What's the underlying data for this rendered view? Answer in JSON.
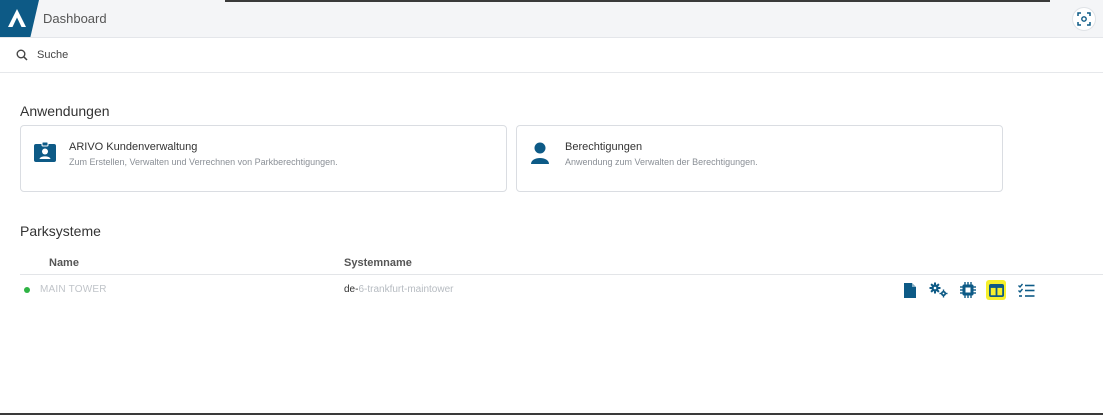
{
  "header": {
    "title": "Dashboard"
  },
  "search": {
    "placeholder": "Suche"
  },
  "applications": {
    "title": "Anwendungen",
    "cards": [
      {
        "title": "ARIVO Kundenverwaltung",
        "description": "Zum Erstellen, Verwalten und Verrechnen von Parkberechtigungen.",
        "icon": "id-badge-icon"
      },
      {
        "title": "Berechtigungen",
        "description": "Anwendung zum Verwalten der Berechtigungen.",
        "icon": "user-icon"
      }
    ]
  },
  "parksysteme": {
    "title": "Parksysteme",
    "columns": [
      "Name",
      "Systemname"
    ],
    "rows": [
      {
        "status": "online",
        "name": "MAIN TOWER",
        "system_prefix": "de-",
        "system_rest": "6-trankfurt-maintower",
        "actions": [
          "document-icon",
          "settings-gears-icon",
          "chip-icon",
          "columns-icon",
          "checklist-icon"
        ]
      }
    ]
  },
  "colors": {
    "brand": "#0d5a86",
    "status_online": "#2fb344",
    "highlight": "#f5f02d"
  }
}
